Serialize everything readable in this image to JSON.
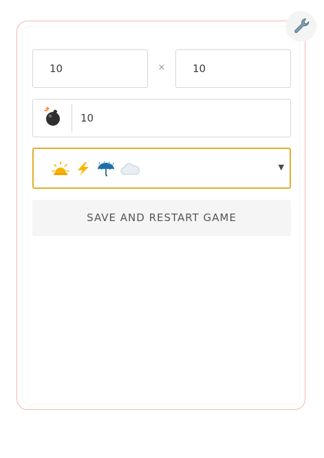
{
  "settings": {
    "icon": "wrench-icon"
  },
  "board": {
    "width_value": "10",
    "height_value": "10",
    "times_symbol": "×"
  },
  "mines": {
    "icon": "bomb-icon",
    "value": "10"
  },
  "theme_select": {
    "icons": [
      "sun-icon",
      "lightning-icon",
      "umbrella-rain-icon",
      "cloud-icon"
    ],
    "caret": "▼",
    "accent_color": "#e0ae2c"
  },
  "actions": {
    "save_label": "SAVE AND RESTART GAME"
  },
  "colors": {
    "panel_border": "#f2b7b3",
    "input_border": "#d6d6d6",
    "button_bg": "#f5f5f5"
  }
}
